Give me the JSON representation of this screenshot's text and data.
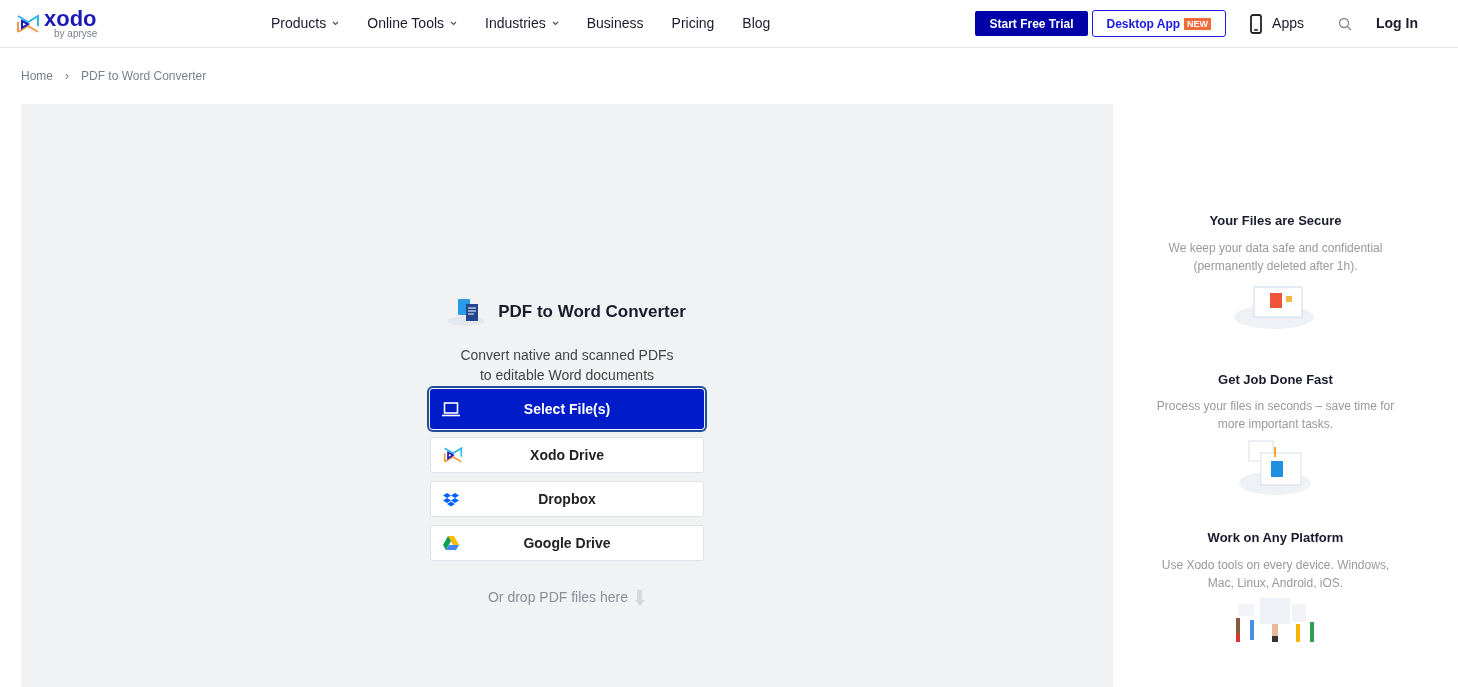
{
  "logo": {
    "name": "xodo",
    "byline": "by apryse"
  },
  "nav": [
    {
      "label": "Products",
      "has_menu": true
    },
    {
      "label": "Online Tools",
      "has_menu": true
    },
    {
      "label": "Industries",
      "has_menu": true
    },
    {
      "label": "Business",
      "has_menu": false
    },
    {
      "label": "Pricing",
      "has_menu": false
    },
    {
      "label": "Blog",
      "has_menu": false
    }
  ],
  "header_actions": {
    "trial": "Start Free Trial",
    "desktop": "Desktop App",
    "desktop_badge": "NEW",
    "apps": "Apps",
    "login": "Log In"
  },
  "breadcrumb": [
    "Home",
    "PDF to Word Converter"
  ],
  "breadcrumb_separator": "›",
  "converter": {
    "title": "PDF to Word Converter",
    "subtitle": [
      "Convert native and scanned PDFs",
      "to editable Word documents"
    ],
    "sources": [
      {
        "label": "Select File(s)",
        "kind": "device",
        "primary": true
      },
      {
        "label": "Xodo Drive",
        "kind": "xodo",
        "primary": false
      },
      {
        "label": "Dropbox",
        "kind": "dropbox",
        "primary": false
      },
      {
        "label": "Google Drive",
        "kind": "gdrive",
        "primary": false
      }
    ],
    "drop_hint": "Or drop PDF files here"
  },
  "features": [
    {
      "title": "Your Files are Secure",
      "text": "We keep your data safe and confidential (permanently deleted after 1h).",
      "kind": "secure"
    },
    {
      "title": "Get Job Done Fast",
      "text": "Process your files in seconds – save time for more important tasks.",
      "kind": "fast"
    },
    {
      "title": "Work on Any Platform",
      "text": "Use Xodo tools on every device. Windows, Mac, Linux, Android, iOS.",
      "kind": "platform"
    }
  ]
}
